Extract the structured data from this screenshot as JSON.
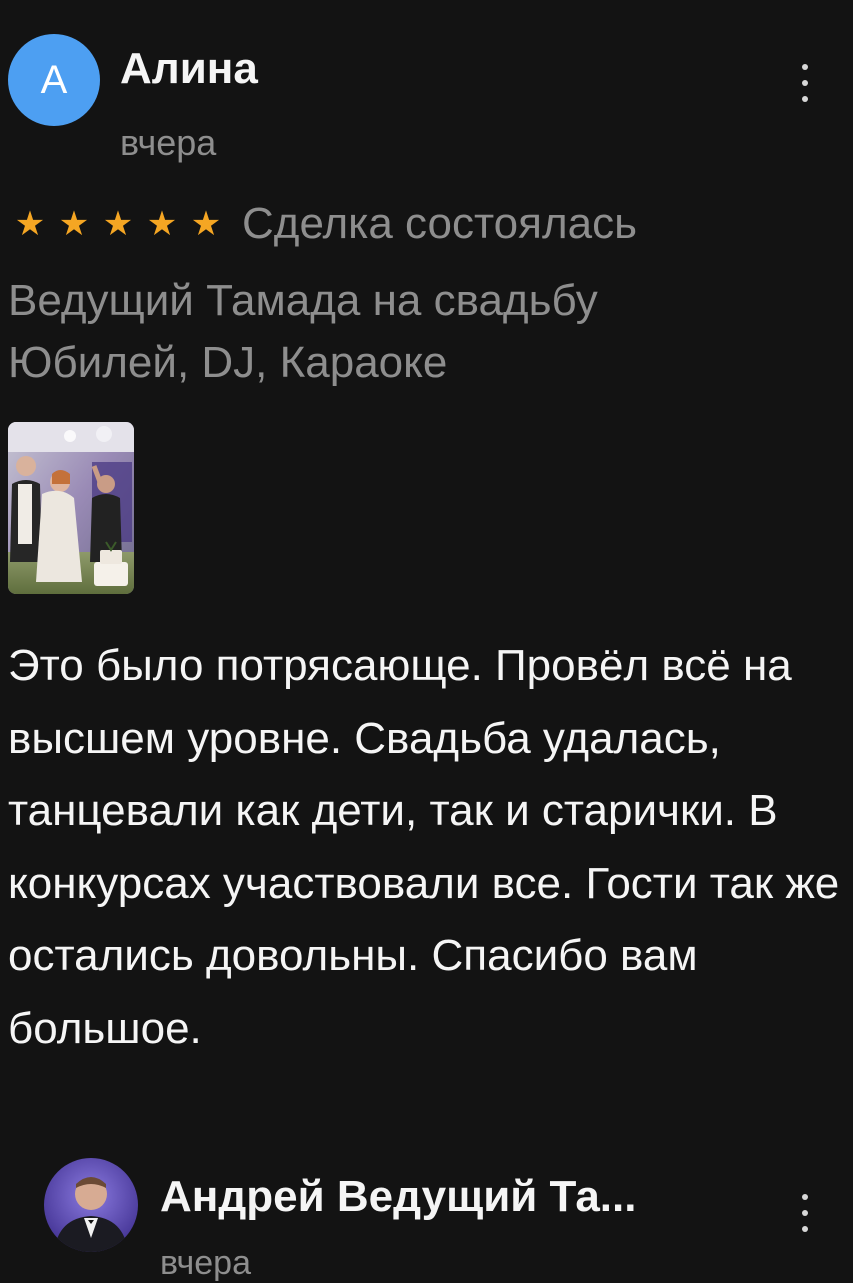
{
  "review": {
    "avatar_letter": "А",
    "author": "Алина",
    "date": "вчера",
    "rating": 5,
    "stars": [
      "★",
      "★",
      "★",
      "★",
      "★"
    ],
    "deal_status": "Сделка состоялась",
    "service_title": "Ведущий Тамада на свадьбу Юбилей, DJ, Караоке",
    "text": "Это было потрясающе. Провёл всё на высшем уровне. Свадьба удалась, танцевали как дети, так и старички. В конкурсах участвовали все. Гости так же остались довольны. Спасибо вам большое.",
    "menu_icon": "more-vertical-icon"
  },
  "reply": {
    "author": "Андрей Ведущий Та...",
    "date": "вчера",
    "menu_icon": "more-vertical-icon"
  },
  "colors": {
    "background": "#131313",
    "avatar_blue": "#4d9ff2",
    "star": "#f5a623",
    "secondary_text": "#8e8e8e"
  }
}
